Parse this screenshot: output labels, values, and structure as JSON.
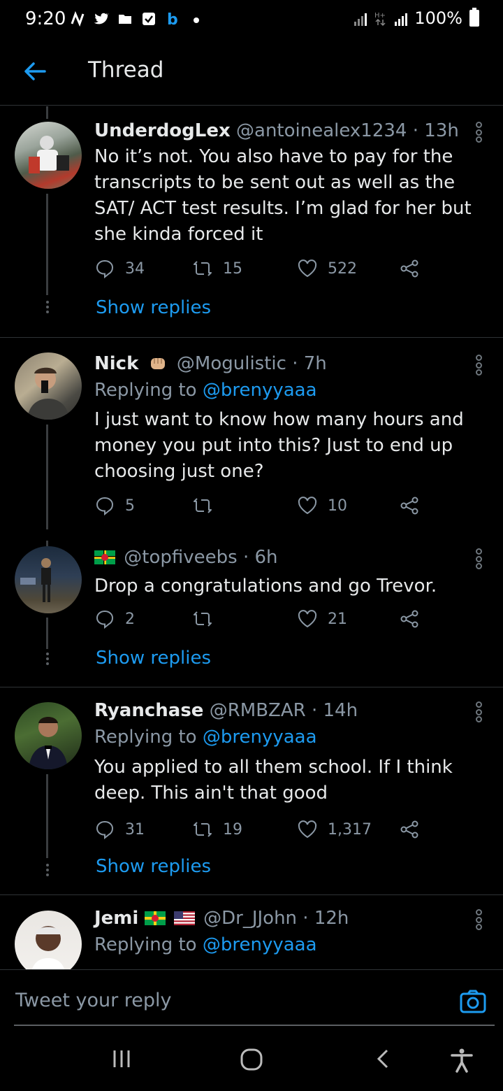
{
  "status_bar": {
    "time": "9:20",
    "battery": "100%"
  },
  "header": {
    "title": "Thread"
  },
  "tweets": [
    {
      "name": "UnderdogLex",
      "handle": "@antoinealex1234 · 13h",
      "text": "No it’s not. You also have to pay for the transcripts to be sent out as well as the SAT/ ACT test results. I’m glad for her but she kinda forced it",
      "replies": "34",
      "retweets": "15",
      "likes": "522",
      "show_replies": "Show replies"
    },
    {
      "name": "Nick",
      "handle": "@Mogulistic · 7h",
      "replying_prefix": "Replying to",
      "replying_to": "@brenyyaaa",
      "text": "I just want to know how many hours and money you put into this? Just to end up choosing just one?",
      "replies": "5",
      "retweets": "",
      "likes": "10"
    },
    {
      "name": "",
      "handle": "@topfiveebs · 6h",
      "text": "Drop a congratulations and go Trevor.",
      "replies": "2",
      "retweets": "",
      "likes": "21",
      "show_replies": "Show replies"
    },
    {
      "name": "Ryanchase",
      "handle": "@RMBZAR · 14h",
      "replying_prefix": "Replying to",
      "replying_to": "@brenyyaaa",
      "text": "You applied to all them school. If I think deep. This ain't that good",
      "replies": "31",
      "retweets": "19",
      "likes": "1,317",
      "show_replies": "Show replies"
    },
    {
      "name": "Jemi",
      "handle": "@Dr_JJohn · 12h",
      "replying_prefix": "Replying to",
      "replying_to": "@brenyyaaa"
    }
  ],
  "reply_bar": {
    "placeholder": "Tweet your reply"
  },
  "colors": {
    "background": "#000000",
    "accent": "#1d9bf0",
    "secondary_text": "#8b98a5",
    "divider": "#2f3336"
  }
}
